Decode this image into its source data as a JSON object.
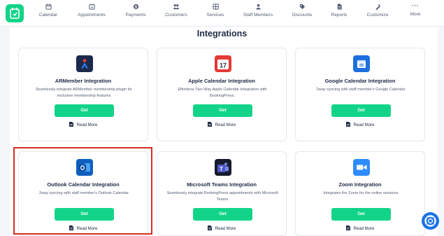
{
  "nav": {
    "items": [
      {
        "label": "Calendar",
        "icon": "calendar-icon"
      },
      {
        "label": "Appointments",
        "icon": "appointments-icon"
      },
      {
        "label": "Payments",
        "icon": "payments-icon"
      },
      {
        "label": "Customers",
        "icon": "customers-icon"
      },
      {
        "label": "Services",
        "icon": "services-icon"
      },
      {
        "label": "Staff Members",
        "icon": "staff-members-icon"
      },
      {
        "label": "Discounts",
        "icon": "discounts-icon"
      },
      {
        "label": "Reports",
        "icon": "reports-icon"
      },
      {
        "label": "Customize",
        "icon": "customize-icon"
      },
      {
        "label": "More",
        "icon": "more-icon"
      }
    ],
    "more_glyph": "···"
  },
  "page": {
    "title": "Integrations"
  },
  "cards": [
    {
      "title": "ARMember Integration",
      "description": "Seamlessly integrate ARMember membership plugin for exclusive membership features",
      "button_label": "Get",
      "read_more_label": "Read More",
      "icon": "armember-icon"
    },
    {
      "title": "Apple Calendar Integration",
      "description": "Effortless Two-Way Apple Calendar Integration with BookingPress.",
      "button_label": "Get",
      "read_more_label": "Read More",
      "icon": "apple-calendar-icon",
      "icon_day": "17"
    },
    {
      "title": "Google Calendar Integration",
      "description": "2way syncing with staff member's Google Calendar",
      "button_label": "Get",
      "read_more_label": "Read More",
      "icon": "google-calendar-icon"
    },
    {
      "title": "Outlook Calendar Integration",
      "description": "2way syncing with staff member's Outlook Calendar",
      "button_label": "Get",
      "read_more_label": "Read More",
      "icon": "outlook-icon"
    },
    {
      "title": "Microsoft Teams Integration",
      "description": "Seamlessly integrate BookingPress appointments with Microsoft Teams",
      "button_label": "Get",
      "read_more_label": "Read More",
      "icon": "microsoft-teams-icon"
    },
    {
      "title": "Zoom Integration",
      "description": "Integrates the Zoom for the online sessions",
      "button_label": "Get",
      "read_more_label": "Read More",
      "icon": "zoom-icon"
    }
  ],
  "colors": {
    "accent": "#12d488",
    "highlight": "#d42e21",
    "help_button": "#1a73e8"
  }
}
